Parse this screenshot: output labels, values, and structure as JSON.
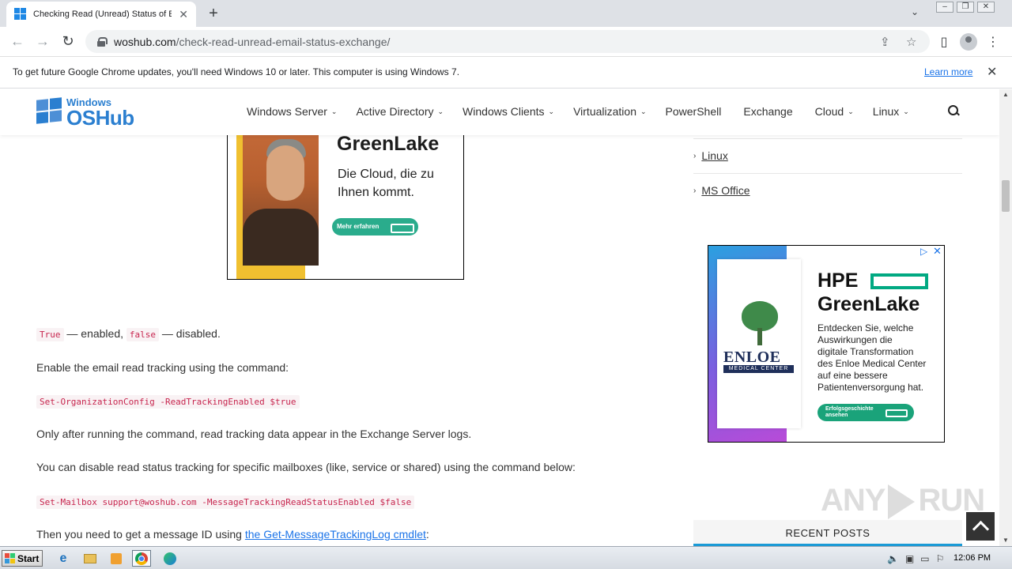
{
  "browser": {
    "tab_title": "Checking Read (Unread) Status of E",
    "url_host": "woshub.com",
    "url_path": "/check-read-unread-email-status-exchange/",
    "infobar_message": "To get future Google Chrome updates, you'll need Windows 10 or later. This computer is using Windows 7.",
    "infobar_link": "Learn more"
  },
  "site": {
    "logo_top": "Windows",
    "logo_bottom": "OSHub",
    "nav": [
      {
        "label": "Windows Server",
        "dropdown": true
      },
      {
        "label": "Active Directory",
        "dropdown": true
      },
      {
        "label": "Windows Clients",
        "dropdown": true
      },
      {
        "label": "Virtualization",
        "dropdown": true
      },
      {
        "label": "PowerShell",
        "dropdown": false
      },
      {
        "label": "Exchange",
        "dropdown": false
      },
      {
        "label": "Cloud",
        "dropdown": true
      },
      {
        "label": "Linux",
        "dropdown": true
      }
    ]
  },
  "ad1": {
    "headline": "GreenLake",
    "text": "Die Cloud, die zu Ihnen kommt.",
    "button": "Mehr erfahren"
  },
  "article": {
    "true_code": "True",
    "mid1": " — enabled, ",
    "false_code": "false",
    "mid2": " — disabled.",
    "p_enable": "Enable the email read tracking using the command:",
    "code_enable": "Set-OrganizationConfig -ReadTrackingEnabled $true",
    "p_only": "Only after running the command, read tracking data appear in the Exchange Server logs.",
    "p_disable": "You can disable read status tracking for specific mailboxes (like, service or shared) using the command below:",
    "code_disable": "Set-Mailbox support@woshub.com -MessageTrackingReadStatusEnabled $false",
    "p_then_before": "Then you need to get a message ID using ",
    "p_then_link": "the Get-MessageTrackingLog cmdlet",
    "p_then_after": ":"
  },
  "sidebar": {
    "links": [
      "Linux",
      "MS Office"
    ],
    "recent_posts": "RECENT POSTS"
  },
  "ad2": {
    "org": "ENLOE",
    "org_sub": "MEDICAL CENTER",
    "brand": "HPE",
    "headline": "GreenLake",
    "text": "Entdecken Sie, welche\nAuswirkungen die\ndigitale Transformation\ndes Enloe Medical Center\nauf eine bessere\nPatientenversorgung hat.",
    "button": "Erfolgsgeschichte\nansehen"
  },
  "watermark": {
    "left": "ANY",
    "right": "RUN"
  },
  "taskbar": {
    "start": "Start",
    "clock": "12:06 PM"
  },
  "colors": {
    "brand_blue": "#2b7fd0",
    "ad_green": "#2aac8c",
    "link_blue": "#1a73e8",
    "code_red": "#c7254e"
  }
}
